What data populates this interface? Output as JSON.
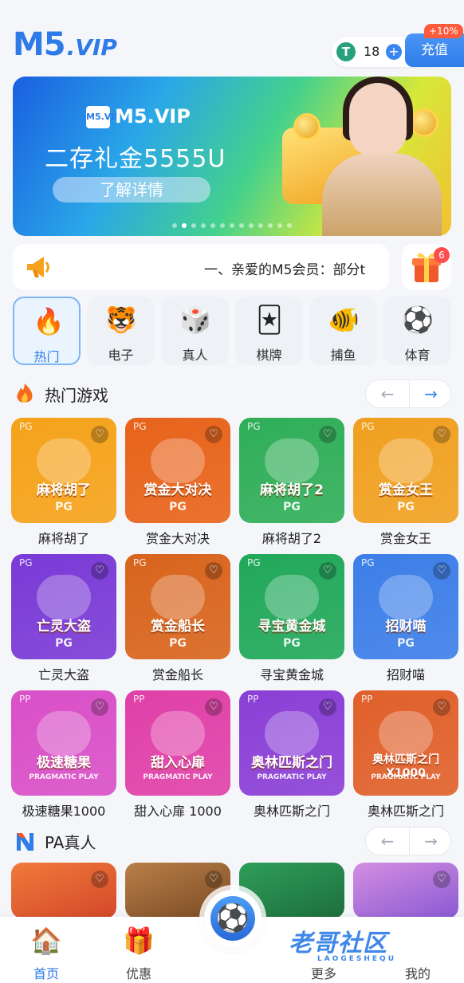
{
  "header": {
    "logo_main": "M5",
    "logo_suffix": ".VIP",
    "balance": "18",
    "currency_icon": "T",
    "recharge_label": "充值",
    "bonus_badge": "+10%"
  },
  "banner": {
    "logo_text": "M5.VIP",
    "logo_box_text": "M5.VIP",
    "title": "二存礼金5555U",
    "button_label": "了解详情",
    "slide_count": 13,
    "active_slide": 1
  },
  "notice": {
    "text": "一、亲爱的M5会员：部分t",
    "gift_badge_count": "6"
  },
  "categories": [
    {
      "label": "热门",
      "icon": "fire-icon",
      "glyph": "🔥"
    },
    {
      "label": "电子",
      "icon": "tiger-icon",
      "glyph": "🐯"
    },
    {
      "label": "真人",
      "icon": "dice-icon",
      "glyph": "🎲"
    },
    {
      "label": "棋牌",
      "icon": "cards-icon",
      "glyph": "🃏"
    },
    {
      "label": "捕鱼",
      "icon": "fish-icon",
      "glyph": "🐠"
    },
    {
      "label": "体育",
      "icon": "soccer-ball-icon",
      "glyph": "⚽"
    }
  ],
  "hot_section": {
    "title": "热门游戏",
    "prev": "←",
    "next": "→",
    "games": [
      {
        "name": "麻将胡了",
        "card_title": "麻将胡了",
        "provider": "PG",
        "vendor": "PG",
        "color": "#f5a21a"
      },
      {
        "name": "赏金大对决",
        "card_title": "赏金大对决",
        "provider": "PG",
        "vendor": "PG",
        "color": "#e8631a"
      },
      {
        "name": "麻将胡了2",
        "card_title": "麻将胡了2",
        "provider": "PG",
        "vendor": "PG",
        "color": "#2fae58"
      },
      {
        "name": "赏金女王",
        "card_title": "赏金女王",
        "provider": "PG",
        "vendor": "PG",
        "color": "#f0a020"
      },
      {
        "name": "亡灵大盗",
        "card_title": "亡灵大盗",
        "provider": "PG",
        "vendor": "PG",
        "color": "#7a3ad6"
      },
      {
        "name": "赏金船长",
        "card_title": "赏金船长",
        "provider": "PG",
        "vendor": "PG",
        "color": "#d8641c"
      },
      {
        "name": "寻宝黄金城",
        "card_title": "寻宝黄金城",
        "provider": "PG",
        "vendor": "PG",
        "color": "#21a85a"
      },
      {
        "name": "招财喵",
        "card_title": "招财喵",
        "provider": "PG",
        "vendor": "PG",
        "color": "#3c7ee8"
      },
      {
        "name": "极速糖果1000",
        "card_title": "极速糖果",
        "provider": "PP",
        "vendor": "PRAGMATIC PLAY",
        "color": "#d94fc7"
      },
      {
        "name": "甜入心扉 1000",
        "card_title": "甜入心扉",
        "provider": "PP",
        "vendor": "PRAGMATIC PLAY",
        "color": "#e040a8"
      },
      {
        "name": "奥林匹斯之门",
        "card_title": "奥林匹斯之门",
        "provider": "PP",
        "vendor": "PRAGMATIC PLAY",
        "color": "#8a3fd6"
      },
      {
        "name": "奥林匹斯之门",
        "card_title": "奥林匹斯之门X1000",
        "provider": "PP",
        "vendor": "PRAGMATIC PLAY",
        "color": "#e0602a"
      }
    ]
  },
  "pa_section": {
    "title": "PA真人",
    "prev": "←",
    "next": "→"
  },
  "bottom_nav": [
    {
      "label": "首页",
      "icon": "home-icon",
      "glyph": "🏠"
    },
    {
      "label": "优惠",
      "icon": "gift-icon",
      "glyph": "🎁"
    },
    {
      "label": "更多",
      "icon": "more-icon",
      "glyph": ""
    },
    {
      "label": "我的",
      "icon": "profile-icon",
      "glyph": ""
    }
  ],
  "center_button_glyph": "⚽",
  "watermark": {
    "main": "老哥社区",
    "sub": "LAOGESHEQU"
  },
  "colors": {
    "accent": "#2f7de8",
    "badge": "#ff4d4f",
    "usdt": "#26a17b"
  }
}
